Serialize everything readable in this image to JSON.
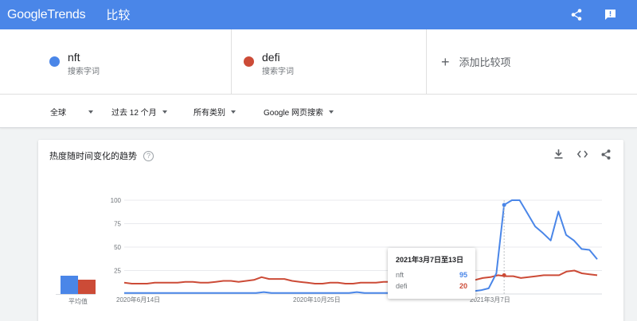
{
  "header": {
    "logo_google": "Google",
    "logo_trends": "Trends",
    "page_title": "比较"
  },
  "terms": [
    {
      "name": "nft",
      "sub": "搜索字词",
      "color": "#4a86e8"
    },
    {
      "name": "defi",
      "sub": "搜索字词",
      "color": "#cc4b37"
    }
  ],
  "add_term_label": "添加比较项",
  "filters": [
    {
      "label": "全球"
    },
    {
      "label": "过去 12 个月"
    },
    {
      "label": "所有类别"
    },
    {
      "label": "Google 网页搜索"
    }
  ],
  "card": {
    "title": "热度随时间变化的趋势",
    "help": "?"
  },
  "averages": {
    "label": "平均值",
    "nft": 19,
    "defi": 15
  },
  "tooltip": {
    "title": "2021年3月7日至13日",
    "rows": [
      {
        "label": "nft",
        "value": "95",
        "color": "#4a86e8"
      },
      {
        "label": "defi",
        "value": "20",
        "color": "#cc4b37"
      }
    ]
  },
  "chart_data": {
    "type": "line",
    "x_tick_labels": [
      "2020年6月14日",
      "2020年10月25日",
      "2021年3月7日"
    ],
    "y_ticks": [
      25,
      50,
      75,
      100
    ],
    "ylim": [
      0,
      100
    ],
    "series": [
      {
        "name": "nft",
        "color": "#4a86e8",
        "values": [
          1,
          1,
          1,
          1,
          1,
          1,
          1,
          1,
          1,
          1,
          1,
          1,
          1,
          1,
          1,
          1,
          1,
          1,
          2,
          1,
          1,
          1,
          1,
          1,
          1,
          1,
          1,
          1,
          1,
          1,
          2,
          1,
          1,
          1,
          1,
          1,
          1,
          1,
          1,
          1,
          1,
          1,
          1,
          2,
          3,
          3,
          4,
          6,
          22,
          95,
          100,
          100,
          86,
          72,
          65,
          57,
          88,
          63,
          57,
          48,
          47,
          37
        ]
      },
      {
        "name": "defi",
        "color": "#cc4b37",
        "values": [
          12,
          11,
          11,
          11,
          12,
          12,
          12,
          12,
          13,
          13,
          12,
          12,
          13,
          14,
          14,
          13,
          14,
          15,
          18,
          16,
          16,
          16,
          14,
          13,
          12,
          11,
          11,
          12,
          12,
          11,
          11,
          12,
          12,
          12,
          13,
          13,
          13,
          12,
          12,
          12,
          12,
          12,
          12,
          12,
          13,
          14,
          15,
          17,
          18,
          20,
          19,
          19,
          17,
          18,
          19,
          20,
          20,
          20,
          24,
          25,
          22,
          21,
          20
        ]
      }
    ]
  }
}
